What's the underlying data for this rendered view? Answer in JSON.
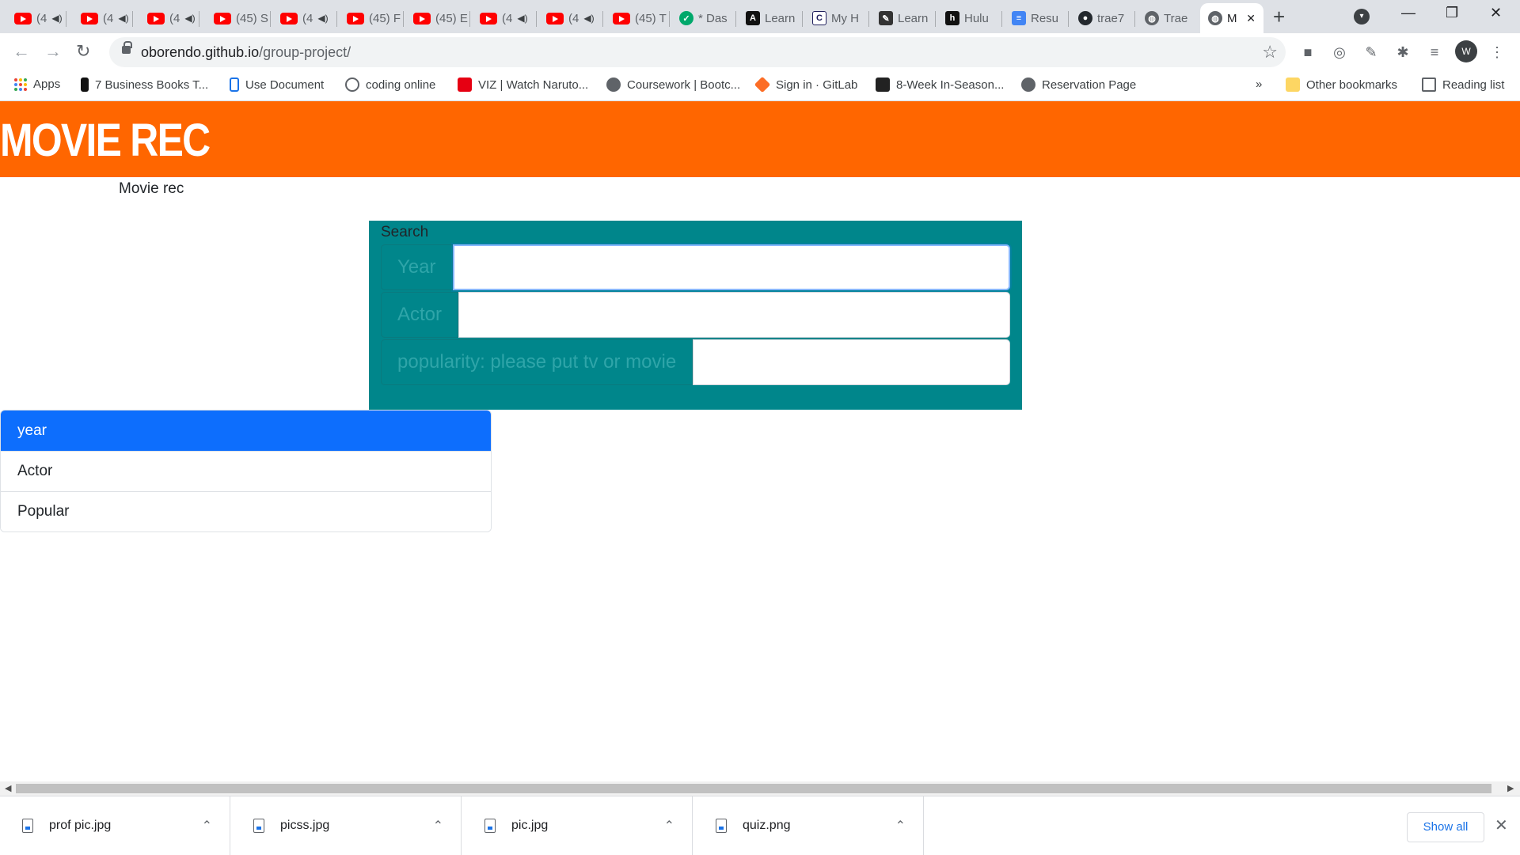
{
  "browser": {
    "tabs": [
      {
        "title": "(4",
        "icon": "youtube-icon",
        "audio": true
      },
      {
        "title": "(4",
        "icon": "youtube-icon",
        "audio": true
      },
      {
        "title": "(4",
        "icon": "youtube-icon",
        "audio": true
      },
      {
        "title": "(45) S",
        "icon": "youtube-icon",
        "audio": false
      },
      {
        "title": "(4",
        "icon": "youtube-icon",
        "audio": true
      },
      {
        "title": "(45) F",
        "icon": "youtube-icon",
        "audio": false
      },
      {
        "title": "(45) E",
        "icon": "youtube-icon",
        "audio": false
      },
      {
        "title": "(4",
        "icon": "youtube-icon",
        "audio": true
      },
      {
        "title": "(4",
        "icon": "youtube-icon",
        "audio": true
      },
      {
        "title": "(45) T",
        "icon": "youtube-icon",
        "audio": false
      },
      {
        "title": "* Das",
        "icon": "dashboard-icon",
        "audio": false
      },
      {
        "title": "Learn",
        "icon": "learn-icon",
        "audio": false
      },
      {
        "title": "My H",
        "icon": "codecademy-icon",
        "audio": false
      },
      {
        "title": "Learn",
        "icon": "learn-icon",
        "audio": false
      },
      {
        "title": "Hulu",
        "icon": "hulu-icon",
        "audio": false
      },
      {
        "title": "Resu",
        "icon": "docs-icon",
        "audio": false
      },
      {
        "title": "trae7",
        "icon": "github-icon",
        "audio": false
      },
      {
        "title": "Trae",
        "icon": "globe-icon",
        "audio": false
      },
      {
        "title": "M",
        "icon": "globe-icon",
        "audio": false,
        "active": true
      }
    ],
    "url_host": "oborendo.github.io",
    "url_path": "/group-project/",
    "profile_initial": "W",
    "bookmarks": [
      {
        "label": "Apps"
      },
      {
        "label": "7 Business Books T..."
      },
      {
        "label": "Use Document"
      },
      {
        "label": "coding online"
      },
      {
        "label": "VIZ | Watch Naruto..."
      },
      {
        "label": "Coursework | Bootc..."
      },
      {
        "label": "Sign in · GitLab"
      },
      {
        "label": "8-Week In-Season..."
      },
      {
        "label": "Reservation Page"
      }
    ],
    "bookmarks_overflow": "»",
    "other_bookmarks": "Other bookmarks",
    "reading_list": "Reading list"
  },
  "page": {
    "logo": "MOVIE REC",
    "subtitle": "Movie rec",
    "search": {
      "label": "Search",
      "fields": [
        {
          "addon": "Year",
          "value": ""
        },
        {
          "addon": "Actor",
          "value": ""
        },
        {
          "addon": "popularity: please put tv or movie",
          "value": ""
        }
      ]
    },
    "list": [
      {
        "label": "year",
        "active": true
      },
      {
        "label": "Actor",
        "active": false
      },
      {
        "label": "Popular",
        "active": false
      }
    ]
  },
  "downloads": {
    "items": [
      {
        "name": "prof pic.jpg"
      },
      {
        "name": "picss.jpg"
      },
      {
        "name": "pic.jpg"
      },
      {
        "name": "quiz.png"
      }
    ],
    "show_all": "Show all"
  },
  "colors": {
    "header": "#ff6600",
    "search_bg": "#00868b",
    "active_item": "#0d6efd"
  }
}
